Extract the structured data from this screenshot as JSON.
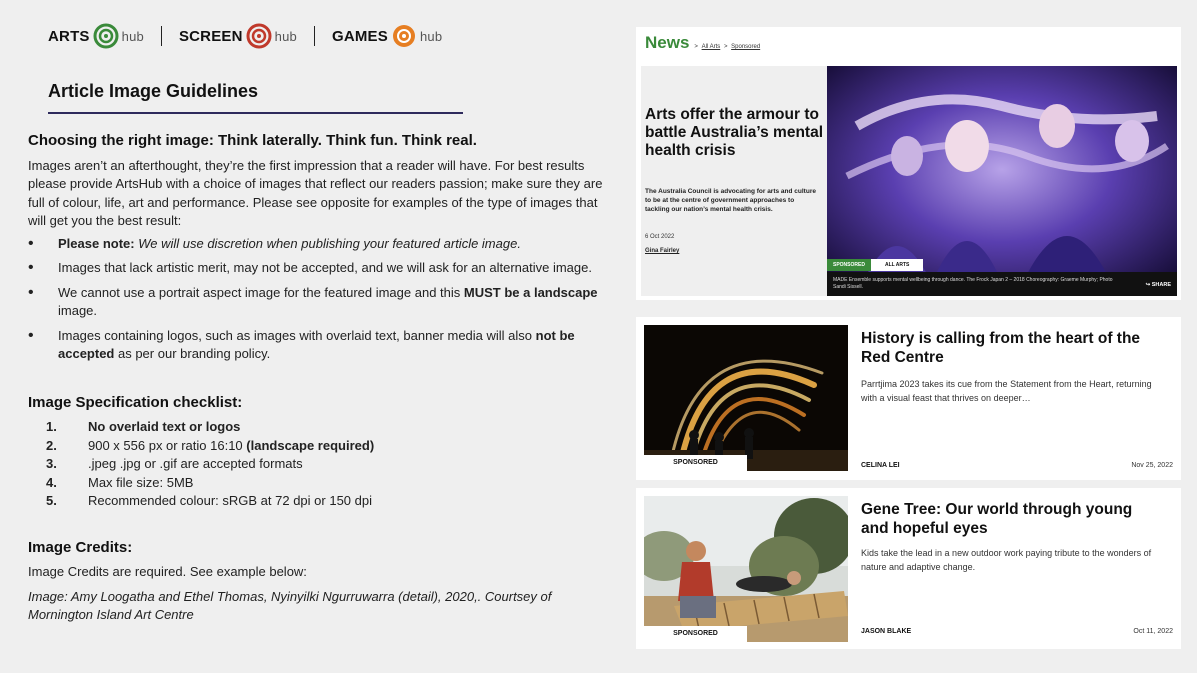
{
  "brands": [
    {
      "name": "ARTS",
      "hub": "hub",
      "color": "#3a8a3a"
    },
    {
      "name": "SCREEN",
      "hub": "hub",
      "color": "#c0392b"
    },
    {
      "name": "GAMES",
      "hub": "hub",
      "color": "#e67e22"
    }
  ],
  "page_title": "Article Image Guidelines",
  "section1": {
    "heading": "Choosing the right image: Think laterally. Think fun. Think real.",
    "intro": "Images aren’t an afterthought, they’re the first impression that a reader will have. For best results please provide ArtsHub with a choice of images that reflect our readers passion; make sure they are full of colour, life, art and performance. Please see opposite for examples of the type of images that will get you the best result:",
    "b1_bold": "Please note:",
    "b1_italic": " We will use discretion when publishing your featured article image.",
    "b2": "Images that lack artistic merit, may not be accepted, and we will ask for an alternative image.",
    "b3_a": "We cannot use a portrait aspect image for the featured image and this ",
    "b3_b": "MUST be a landscape",
    "b3_c": " image.",
    "b4_a": "Images containing logos, such as images with overlaid text, banner media will also ",
    "b4_b": "not be accepted",
    "b4_c": " as per our branding policy."
  },
  "checklist": {
    "heading": "Image Specification checklist:",
    "i1_num": "1.",
    "i1": "No overlaid text or logos",
    "i2_num": "2.",
    "i2_a": "900 x 556 px or ratio 16:10 ",
    "i2_b": "(landscape required)",
    "i3_num": "3.",
    "i3": ".jpeg .jpg or .gif are accepted formats",
    "i4_num": "4.",
    "i4": "Max file size: 5MB",
    "i5_num": "5.",
    "i5": "Recommended colour: sRGB at 72 dpi or 150 dpi"
  },
  "credits": {
    "heading": "Image Credits:",
    "text": "Image Credits are required. See example below:",
    "example": "Image: Amy Loogatha and Ethel Thomas, Nyinyilki Ngurruwarra (detail), 2020,. Courtsey of Mornington Island Art Centre"
  },
  "news": {
    "label": "News",
    "crumb_sep": ">",
    "crumb1": "All Arts",
    "crumb2": "Sponsored",
    "headline": "Arts offer the armour to battle Australia’s mental health crisis",
    "summary": "The Australia Council is advocating for arts and culture to be at the centre of government approaches to tackling our nation’s mental health crisis.",
    "date": "6 Oct 2022",
    "author": "Gina Fairley",
    "tag1": "SPONSORED",
    "tag2": "ALL ARTS",
    "caption": "MADE Ensemble supports mental wellbeing through dance. The Frock Japan 2 – 2018 Choreography: Graeme Murphy; Photo Sandi Sissell.",
    "share": "SHARE"
  },
  "articles": [
    {
      "title": "History is calling from the heart of the Red Centre",
      "excerpt": "Parrtjima 2023 takes its cue from the Statement from the Heart, returning with a visual feast that thrives on deeper…",
      "badge": "SPONSORED",
      "author": "CELINA LEI",
      "date": "Nov 25, 2022"
    },
    {
      "title": "Gene Tree: Our world through young and hopeful eyes",
      "excerpt": "Kids take the lead in a new outdoor work paying tribute to the wonders of nature and adaptive change.",
      "badge": "SPONSORED",
      "author": "JASON BLAKE",
      "date": "Oct 11, 2022"
    }
  ]
}
